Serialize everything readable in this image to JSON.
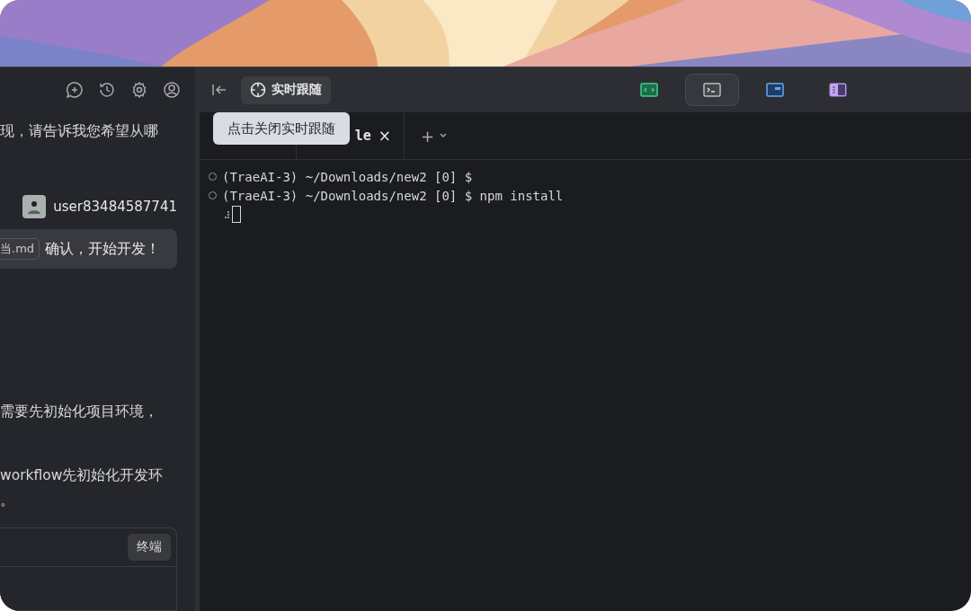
{
  "chat_panel": {
    "assistant_top": "现，请告诉我您希望从哪",
    "user_message": {
      "username": "user83484587741",
      "file_chip": "当.md",
      "text": "确认，开始开发！"
    },
    "assistant_lines": [
      "需要先初始化项目环境，",
      "workflow先初始化开发环",
      "。"
    ],
    "command_card": {
      "button": "终端"
    }
  },
  "toolbar": {
    "follow_button": "实时跟随",
    "tooltip": "点击关闭实时跟随",
    "view_buttons": [
      {
        "kind": "code",
        "selected": false
      },
      {
        "kind": "terminal",
        "selected": true
      },
      {
        "kind": "browser",
        "selected": false
      },
      {
        "kind": "docs",
        "selected": false
      }
    ]
  },
  "terminal": {
    "tabs": [
      {
        "label": "le",
        "close": "×"
      }
    ],
    "new_tab": "+",
    "lines": [
      {
        "text": "(TraeAI-3) ~/Downloads/new2 [0] $"
      },
      {
        "text": "(TraeAI-3) ~/Downloads/new2 [0] $ npm install"
      }
    ],
    "cursor": true
  }
}
